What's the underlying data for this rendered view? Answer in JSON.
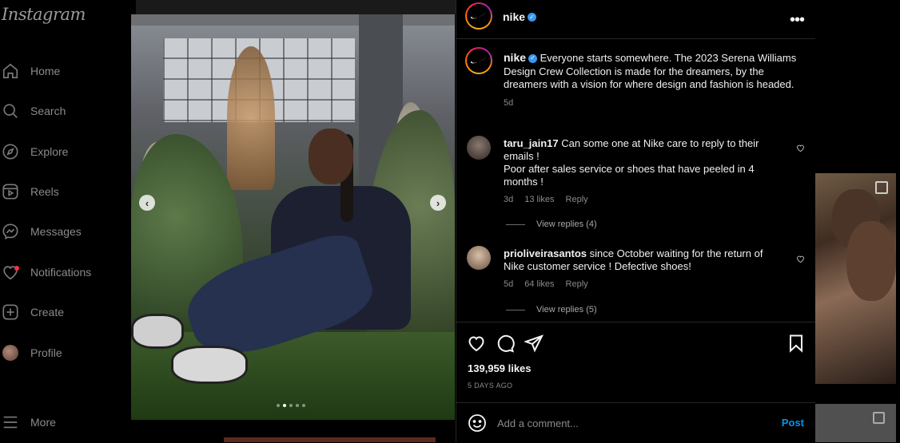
{
  "sidebar": {
    "logo": "Instagram",
    "items": [
      {
        "label": "Home",
        "icon": "home-icon"
      },
      {
        "label": "Search",
        "icon": "search-icon"
      },
      {
        "label": "Explore",
        "icon": "compass-icon"
      },
      {
        "label": "Reels",
        "icon": "reels-icon"
      },
      {
        "label": "Messages",
        "icon": "messenger-icon"
      },
      {
        "label": "Notifications",
        "icon": "heart-icon"
      },
      {
        "label": "Create",
        "icon": "plus-square-icon"
      },
      {
        "label": "Profile",
        "icon": "avatar"
      }
    ],
    "more_label": "More"
  },
  "post": {
    "carousel": {
      "prev": "‹",
      "next": "›",
      "dot_count": 5,
      "active_dot": 1
    },
    "header": {
      "username": "nike",
      "verified": true
    },
    "caption": {
      "username": "nike",
      "text": "Everyone starts somewhere. The 2023 Serena Williams Design Crew Collection is made for the dreamers, by the dreamers with a vision for where design and fashion is headed.",
      "age": "5d"
    },
    "comments": [
      {
        "username": "taru_jain17",
        "text_line1": "Can some one at Nike care to reply to their emails !",
        "text_line2": "Poor after sales service or shoes that have peeled in 4 months !",
        "age": "3d",
        "likes": "13 likes",
        "reply": "Reply",
        "view_replies": "View replies (4)"
      },
      {
        "username": "prioliveirasantos",
        "text_line1": "since October waiting for the return of Nike customer service ! Defective shoes!",
        "age": "5d",
        "likes": "64 likes",
        "reply": "Reply",
        "view_replies": "View replies (5)"
      }
    ],
    "likes_count": "139,959 likes",
    "posted_ago": "5 DAYS AGO",
    "comment_input": {
      "placeholder": "Add a comment...",
      "post_label": "Post"
    }
  },
  "colors": {
    "accent": "#0095f6",
    "verified": "#3897f0",
    "notification_dot": "#ff3040"
  }
}
